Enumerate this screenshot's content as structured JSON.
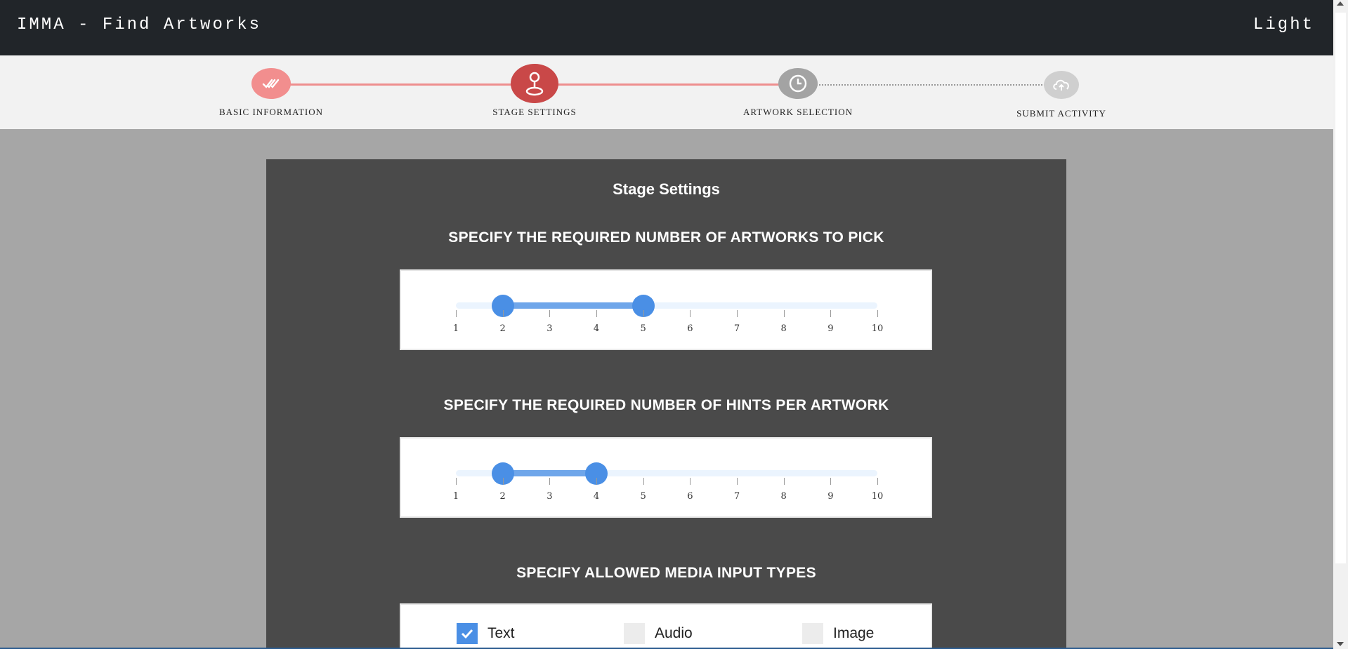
{
  "header": {
    "title": "IMMA - Find Artworks",
    "theme_toggle": "Light"
  },
  "stepper": {
    "steps": [
      {
        "label": "BASIC INFORMATION",
        "icon": "double-check-icon",
        "state": "completed",
        "color": "#f28e8e"
      },
      {
        "label": "STAGE SETTINGS",
        "icon": "map-pin-icon",
        "state": "active",
        "color": "#c94848"
      },
      {
        "label": "ARTWORK SELECTION",
        "icon": "clock-icon",
        "state": "upcoming",
        "color": "#a3a3a3"
      },
      {
        "label": "SUBMIT ACTIVITY",
        "icon": "cloud-upload-icon",
        "state": "upcoming",
        "color": "#cfcfcf"
      }
    ]
  },
  "panel": {
    "title": "Stage Settings",
    "artworks_section": {
      "title": "SPECIFY THE REQUIRED NUMBER OF ARTWORKS TO PICK",
      "min": 1,
      "max": 10,
      "value_low": 2,
      "value_high": 5,
      "ticks": [
        "1",
        "2",
        "3",
        "4",
        "5",
        "6",
        "7",
        "8",
        "9",
        "10"
      ]
    },
    "hints_section": {
      "title": "SPECIFY THE REQUIRED NUMBER OF HINTS PER ARTWORK",
      "min": 1,
      "max": 10,
      "value_low": 2,
      "value_high": 4,
      "ticks": [
        "1",
        "2",
        "3",
        "4",
        "5",
        "6",
        "7",
        "8",
        "9",
        "10"
      ]
    },
    "media_section": {
      "title": "SPECIFY ALLOWED MEDIA INPUT TYPES",
      "options": [
        {
          "label": "Text",
          "checked": true
        },
        {
          "label": "Audio",
          "checked": false
        },
        {
          "label": "Image",
          "checked": false
        }
      ]
    }
  },
  "colors": {
    "accent": "#4a8fe5",
    "header_bg": "#212529",
    "panel_bg": "#4a4a4a",
    "page_bg": "#a6a6a6"
  }
}
